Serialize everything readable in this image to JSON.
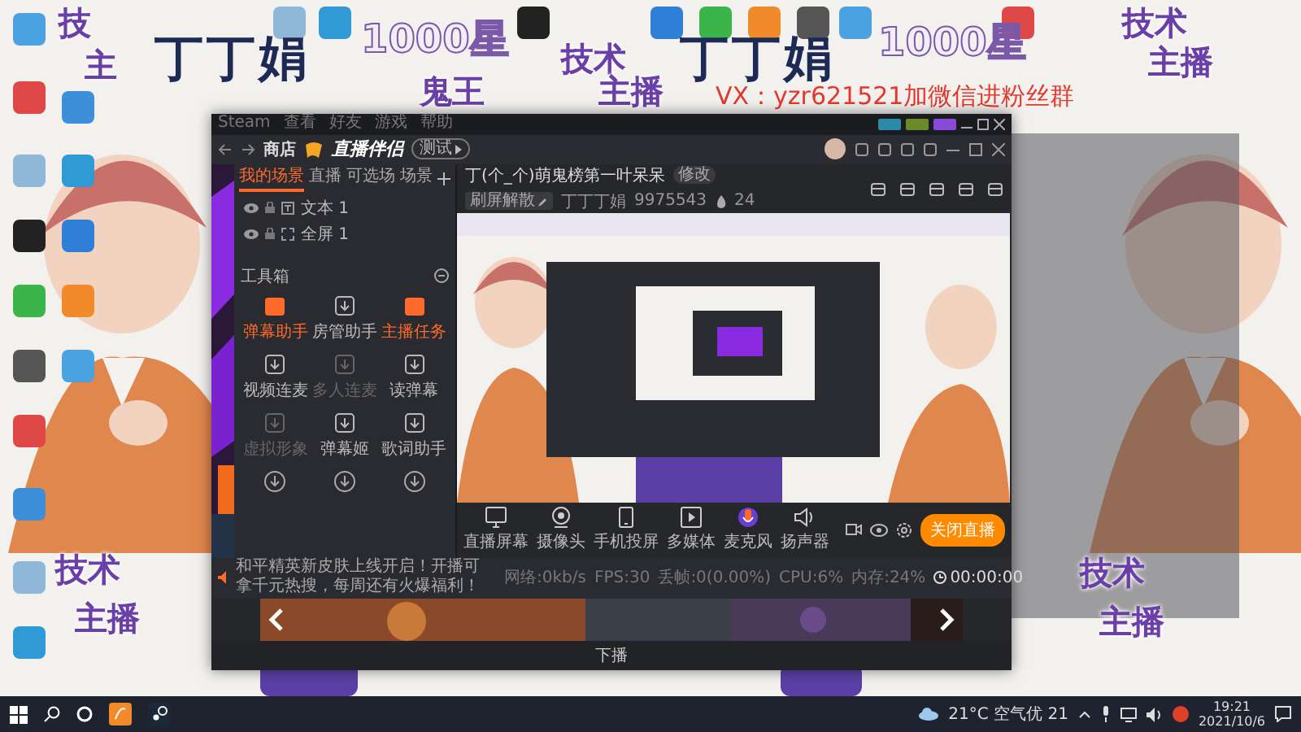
{
  "overlay_texts": [
    {
      "text": "技",
      "kind": "tag"
    },
    {
      "text": "主",
      "kind": "tag"
    },
    {
      "text": "丁丁娟",
      "kind": "title"
    },
    {
      "text": "1000星",
      "kind": "star"
    },
    {
      "text": "技术",
      "kind": "tag"
    },
    {
      "text": "鬼王",
      "kind": "tag"
    },
    {
      "text": "主播",
      "kind": "tag"
    },
    {
      "text": "丁丁娟",
      "kind": "title"
    },
    {
      "text": "1000星",
      "kind": "star"
    },
    {
      "text": "技术",
      "kind": "tag"
    },
    {
      "text": "主播",
      "kind": "tag"
    },
    {
      "text": "VX：yzr621521加微信进粉丝群",
      "kind": "contact"
    },
    {
      "text": "技术",
      "kind": "tag"
    },
    {
      "text": "主播",
      "kind": "tag"
    },
    {
      "text": "技术",
      "kind": "tag"
    },
    {
      "text": "主播",
      "kind": "tag"
    }
  ],
  "steam_menu": [
    "Steam",
    "查看",
    "好友",
    "游戏",
    "帮助"
  ],
  "header": {
    "store": "商店",
    "logo": "直播伴侣",
    "badge": "测试"
  },
  "scene_tabs": [
    {
      "label": "我的场景",
      "selected": true
    },
    {
      "label": "直播",
      "selected": false
    },
    {
      "label": "可选场",
      "selected": false
    },
    {
      "label": "场景",
      "selected": false
    }
  ],
  "scenes": [
    {
      "name": "文本 1",
      "kind": "text"
    },
    {
      "name": "全屏 1",
      "kind": "fullscreen"
    }
  ],
  "toolbox": {
    "title": "工具箱",
    "items": [
      {
        "label": "弹幕助手",
        "active": true,
        "disabled": false
      },
      {
        "label": "房管助手",
        "active": false,
        "disabled": false
      },
      {
        "label": "主播任务",
        "active": true,
        "disabled": false
      },
      {
        "label": "视频连麦",
        "active": false,
        "disabled": false
      },
      {
        "label": "多人连麦",
        "active": false,
        "disabled": true
      },
      {
        "label": "读弹幕",
        "active": false,
        "disabled": false
      },
      {
        "label": "虚拟形象",
        "active": false,
        "disabled": true
      },
      {
        "label": "弹幕姬",
        "active": false,
        "disabled": false
      },
      {
        "label": "歌词助手",
        "active": false,
        "disabled": false
      }
    ]
  },
  "stream": {
    "title": "丁(个_个)萌鬼榜第一叶呆呆",
    "tag": "修改",
    "category": "刷屏解散",
    "name": "丁丁丁娟",
    "id": "9975543",
    "likes": "24"
  },
  "controls": [
    {
      "label": "直播屏幕",
      "kind": "screen"
    },
    {
      "label": "摄像头",
      "kind": "camera"
    },
    {
      "label": "手机投屏",
      "kind": "phone"
    },
    {
      "label": "多媒体",
      "kind": "media"
    },
    {
      "label": "麦克风",
      "kind": "mic"
    },
    {
      "label": "扬声器",
      "kind": "speaker"
    }
  ],
  "live_button": "关闭直播",
  "notice": "和平精英新皮肤上线开启！开播可拿千元热搜，每周还有火爆福利！",
  "stats": [
    "网络:0kb/s",
    "FPS:30",
    "丢帧:0(0.00%)",
    "CPU:6%",
    "内存:24%"
  ],
  "timer": "00:00:00",
  "footer": {
    "center": "下播"
  },
  "taskbar": {
    "weather": "21°C 空气优 21",
    "time": "19:21",
    "date": "2021/10/6"
  }
}
